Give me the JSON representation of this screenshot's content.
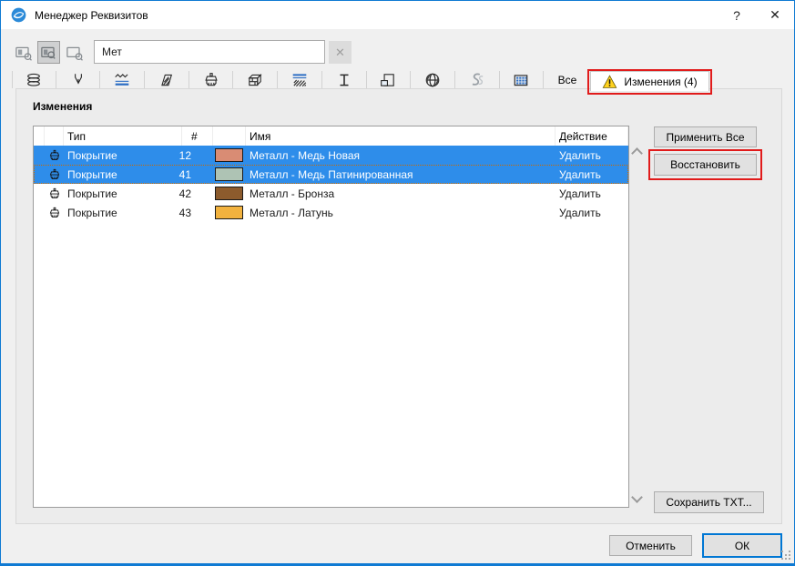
{
  "window": {
    "title": "Менеджер Реквизитов",
    "help_label": "?",
    "close_label": "✕"
  },
  "toolbar": {
    "filter_buttons": [
      "search-index-icon",
      "search-index-and-name-icon",
      "search-name-icon"
    ],
    "active_filter_index": 1,
    "search_value": "Мет",
    "clear_label": "✕"
  },
  "tabs": {
    "icon_tabs": [
      "layers-icon",
      "pens-icon",
      "line-types-icon",
      "fill-types-icon",
      "surfaces-icon",
      "composites-icon",
      "building-materials-icon",
      "profiles-icon",
      "zone-categories-icon",
      "cities-icon",
      "operation-profiles-icon",
      "mep-systems-icon"
    ],
    "all_label": "Все",
    "changes_label": "Изменения (4)",
    "changes_icon": "warning-icon",
    "active_tab": "Изменения (4)"
  },
  "panel": {
    "section_title": "Изменения"
  },
  "table": {
    "columns": {
      "type": "Тип",
      "number": "#",
      "name": "Имя",
      "action": "Действие"
    },
    "rows": [
      {
        "type": "Покрытие",
        "number": "12",
        "color": "#d98c74",
        "name": "Металл - Медь Новая",
        "action": "Удалить",
        "selected": true,
        "focused": false
      },
      {
        "type": "Покрытие",
        "number": "41",
        "color": "#aec3b4",
        "name": "Металл - Медь Патинированная",
        "action": "Удалить",
        "selected": true,
        "focused": true
      },
      {
        "type": "Покрытие",
        "number": "42",
        "color": "#8c5b2d",
        "name": "Металл - Бронза",
        "action": "Удалить",
        "selected": false,
        "focused": false
      },
      {
        "type": "Покрытие",
        "number": "43",
        "color": "#f2b23e",
        "name": "Металл - Латунь",
        "action": "Удалить",
        "selected": false,
        "focused": false
      }
    ]
  },
  "buttons": {
    "apply_all": "Применить Все",
    "restore": "Восстановить",
    "save_txt": "Сохранить TXT...",
    "cancel": "Отменить",
    "ok": "ОК"
  },
  "annotations": {
    "color": "#e11b1b",
    "targets": [
      "changes-tab",
      "restore-button"
    ]
  },
  "colors": {
    "selection_blue": "#2e8dea",
    "window_border_blue": "#0f7ad3",
    "warning_yellow": "#ffd21e"
  }
}
